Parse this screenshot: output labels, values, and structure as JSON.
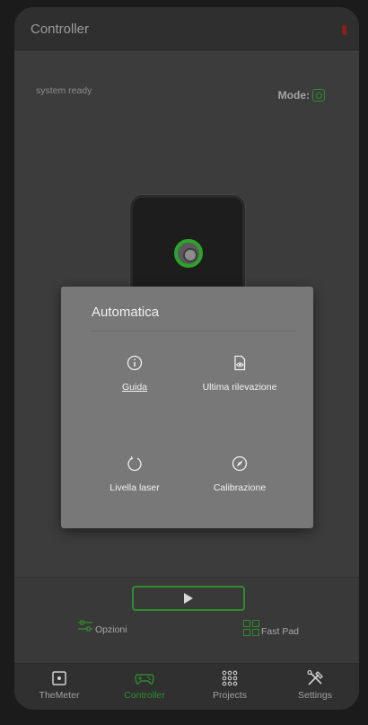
{
  "appbar": {
    "title": "Controller"
  },
  "status": {
    "text": "system ready",
    "mode_label": "Mode:"
  },
  "dialog": {
    "title": "Automatica",
    "options": [
      {
        "label": "Guida",
        "icon": "info-icon"
      },
      {
        "label": "Ultima rilevazione",
        "icon": "document-eye-icon"
      },
      {
        "label": "Livella laser",
        "icon": "refresh-icon"
      },
      {
        "label": "Calibrazione",
        "icon": "compass-icon"
      }
    ]
  },
  "controls": {
    "play_icon": "play-icon",
    "opzioni_label": "Opzioni",
    "fastpad_label": "Fast Pad"
  },
  "nav": [
    {
      "label": "TheMeter",
      "icon": "device-icon",
      "active": false
    },
    {
      "label": "Controller",
      "icon": "gamepad-icon",
      "active": true
    },
    {
      "label": "Projects",
      "icon": "dots-grid-icon",
      "active": false
    },
    {
      "label": "Settings",
      "icon": "tools-icon",
      "active": false
    }
  ],
  "colors": {
    "accent": "#2e8b2e",
    "background": "#3c3c3c",
    "dialog": "#787878",
    "alert": "#8a1d1d"
  }
}
